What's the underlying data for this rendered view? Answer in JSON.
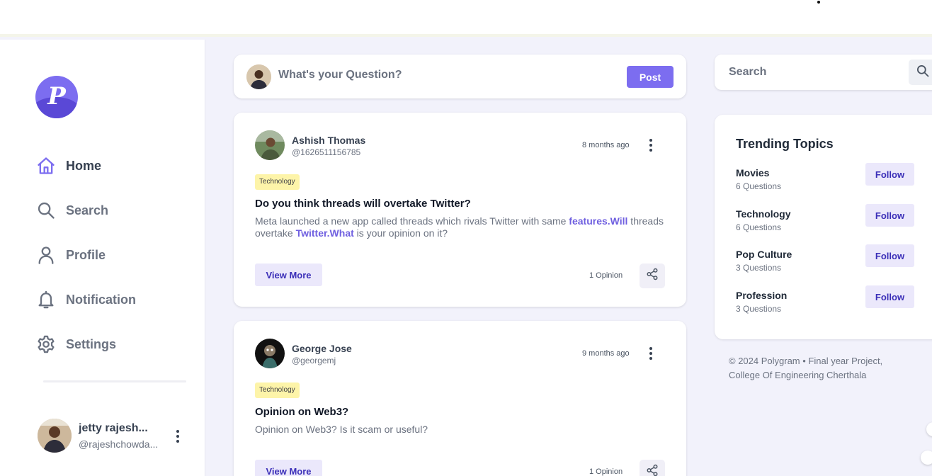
{
  "brand": {
    "logo_letter": "P",
    "accent": "#7c6df0"
  },
  "nav": {
    "items": [
      {
        "label": "Home",
        "icon": "home-icon"
      },
      {
        "label": "Search",
        "icon": "search-icon"
      },
      {
        "label": "Profile",
        "icon": "user-icon"
      },
      {
        "label": "Notification",
        "icon": "bell-icon"
      },
      {
        "label": "Settings",
        "icon": "gear-icon"
      }
    ]
  },
  "current_user": {
    "name": "jetty rajesh...",
    "handle": "@rajeshchowda..."
  },
  "ask": {
    "placeholder": "What's your Question?",
    "post_label": "Post"
  },
  "posts": [
    {
      "author": "Ashish Thomas",
      "handle": "@1626511156785",
      "time": "8 months ago",
      "tag": "Technology",
      "title": "Do you think threads will overtake Twitter?",
      "body": {
        "part1": "Meta launched a new app called threads which rivals Twitter with same ",
        "link1": "features.Will",
        "part2": " threads overtake ",
        "link2": "Twitter.What",
        "part3": " is your opinion on it?"
      },
      "view_more": "View More",
      "opinions": "1 Opinion"
    },
    {
      "author": "George Jose",
      "handle": "@georgemj",
      "time": "9 months ago",
      "tag": "Technology",
      "title": "Opinion on Web3?",
      "body": {
        "text": "Opinion on Web3? Is it scam or useful?"
      },
      "view_more": "View More",
      "opinions": "1 Opinion"
    }
  ],
  "search": {
    "placeholder": "Search"
  },
  "trending": {
    "title": "Trending Topics",
    "follow_label": "Follow",
    "topics": [
      {
        "name": "Movies",
        "count": "6 Questions"
      },
      {
        "name": "Technology",
        "count": "6 Questions"
      },
      {
        "name": "Pop Culture",
        "count": "3 Questions"
      },
      {
        "name": "Profession",
        "count": "3 Questions"
      }
    ]
  },
  "footer": {
    "text": "© 2024 Polygram • Final year Project, College Of Engineering Cherthala"
  }
}
